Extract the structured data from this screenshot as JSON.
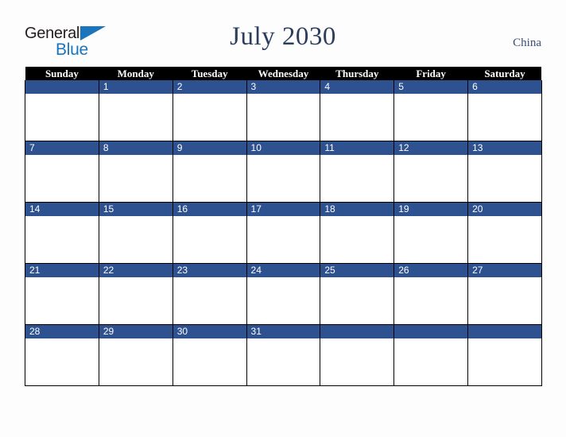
{
  "logo": {
    "word_dark": "General",
    "word_blue": "Blue",
    "triangle_icon": "triangle-icon",
    "dark_color": "#231f20",
    "blue_color": "#1b75bc"
  },
  "header": {
    "title": "July 2030",
    "country": "China",
    "title_color": "#2b3e5e"
  },
  "calendar": {
    "header_bg": "#000000",
    "header_text_color": "#ffffff",
    "date_band_color": "#2e5190",
    "date_text_color": "#ffffff",
    "cell_bg": "#ffffff",
    "grid_line_color": "#000000",
    "weekdays": [
      "Sunday",
      "Monday",
      "Tuesday",
      "Wednesday",
      "Thursday",
      "Friday",
      "Saturday"
    ],
    "weeks": [
      [
        "",
        "1",
        "2",
        "3",
        "4",
        "5",
        "6"
      ],
      [
        "7",
        "8",
        "9",
        "10",
        "11",
        "12",
        "13"
      ],
      [
        "14",
        "15",
        "16",
        "17",
        "18",
        "19",
        "20"
      ],
      [
        "21",
        "22",
        "23",
        "24",
        "25",
        "26",
        "27"
      ],
      [
        "28",
        "29",
        "30",
        "31",
        "",
        "",
        ""
      ]
    ]
  },
  "page": {
    "background": "#fdfdfd"
  }
}
